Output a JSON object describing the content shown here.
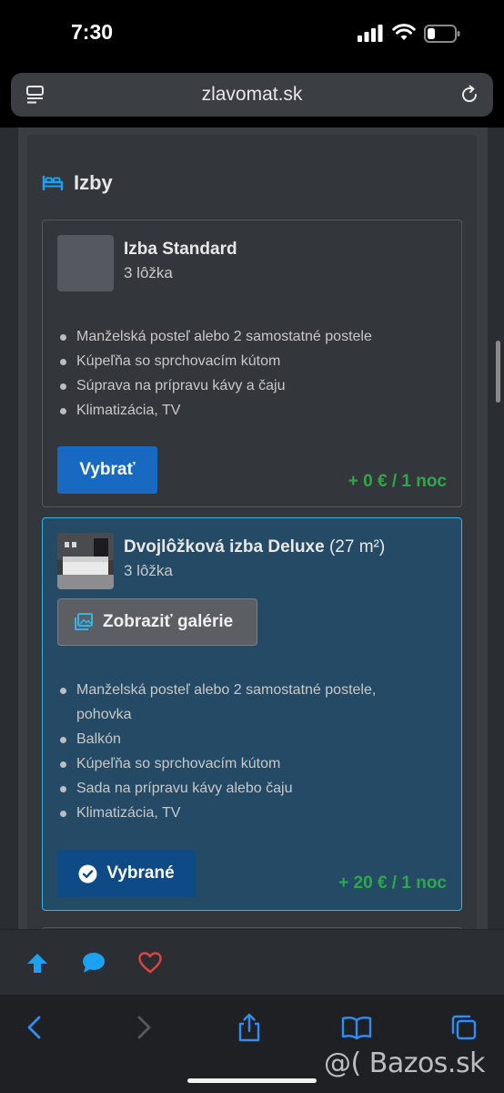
{
  "status_bar": {
    "time": "7:30"
  },
  "browser": {
    "url": "zlavomat.sk"
  },
  "section": {
    "title": "Izby"
  },
  "rooms": [
    {
      "name": "Izba Standard",
      "area": "",
      "beds": "3 lôžka",
      "features": [
        "Manželská posteľ alebo 2 samostatné postele",
        "Kúpeľňa so sprchovacím kútom",
        "Súprava na prípravu kávy a čaju",
        "Klimatizácia, TV"
      ],
      "button_label": "Vybrať",
      "price": "+ 0 € / 1 noc"
    },
    {
      "name": "Dvojlôžková izba Deluxe",
      "area": "(27 m²)",
      "beds": "3 lôžka",
      "gallery_label": "Zobraziť galérie",
      "features": [
        "Manželská posteľ alebo 2 samostatné postele, pohovka",
        "Balkón",
        "Kúpeľňa so sprchovacím kútom",
        "Sada na prípravu kávy alebo čaju",
        "Klimatizácia, TV"
      ],
      "button_label": "Vybrané",
      "price": "+ 20 € / 1 noc"
    }
  ],
  "watermark": "@( Bazos.sk",
  "colors": {
    "accent_blue": "#1769c2",
    "selected_border": "#36b3e8",
    "price_green": "#2ea84a",
    "heart_red": "#e0443c",
    "icon_blue": "#1da1f2"
  },
  "icons": {
    "address_left": "tabs-icon",
    "address_right": "reload-icon",
    "section": "bed-icon",
    "actions": [
      "arrow-up-icon",
      "chat-bubble-icon",
      "heart-icon"
    ],
    "toolbar": [
      "back-icon",
      "forward-icon",
      "share-icon",
      "bookmarks-icon",
      "tabs-overview-icon"
    ]
  }
}
